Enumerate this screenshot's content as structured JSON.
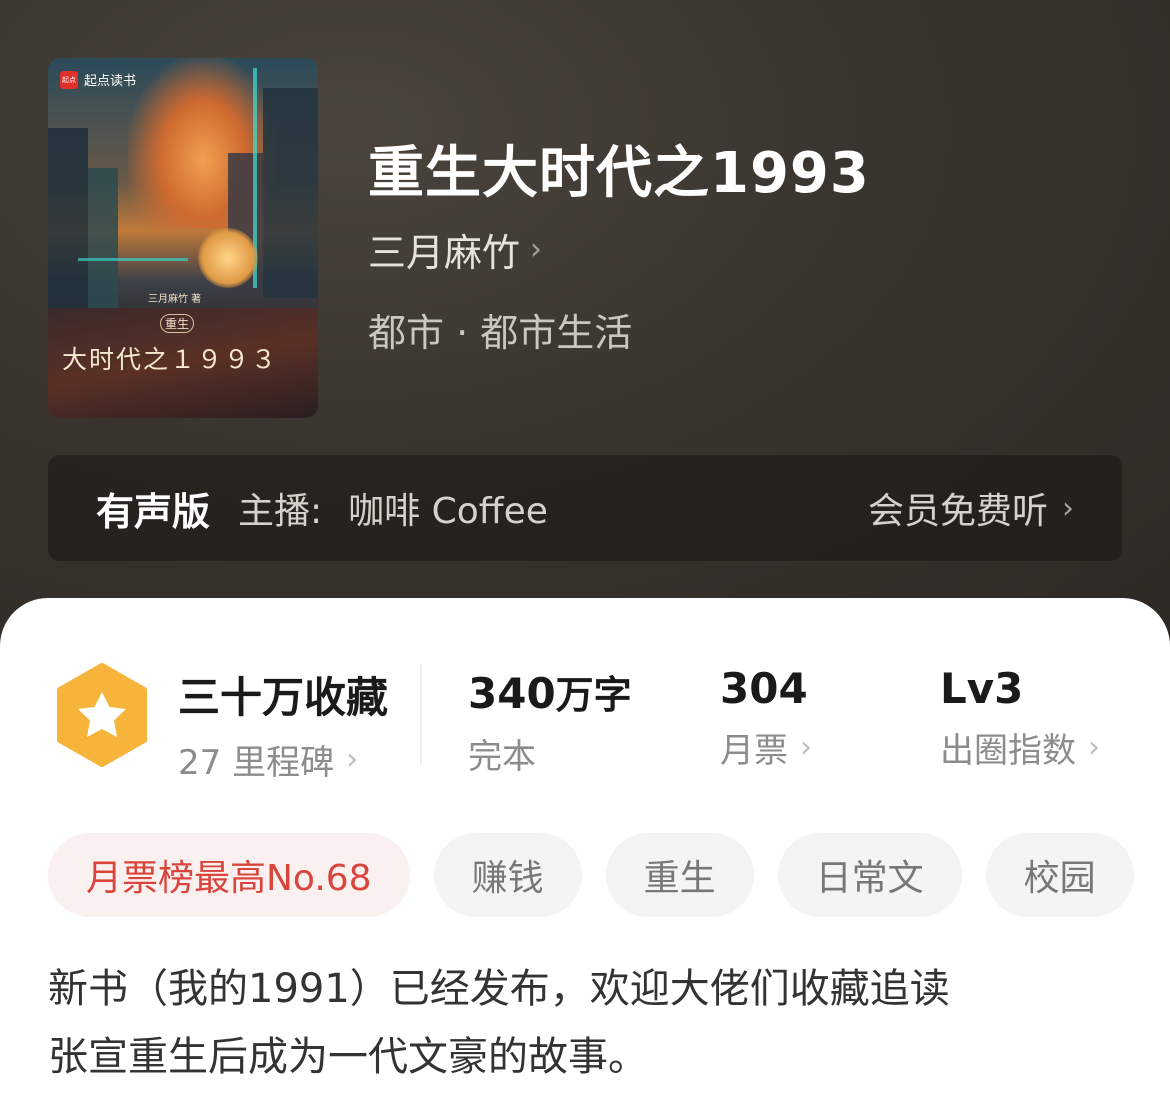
{
  "book": {
    "title": "重生大时代之1993",
    "author": "三月麻竹",
    "genre": "都市 · 都市生活",
    "cover": {
      "brand": "起点读书",
      "brand_logo": "起点",
      "author_line": "三月麻竹 著",
      "subtitle": "重生",
      "title_line": "大时代之１９９３"
    }
  },
  "audio": {
    "label": "有声版",
    "host_prefix": "主播:",
    "host_name": "咖啡 Coffee",
    "cta": "会员免费听"
  },
  "stats": {
    "collection": {
      "value": "三十万收藏",
      "sub": "27 里程碑"
    },
    "words": {
      "value": "340",
      "unit": "万字",
      "sub": "完本"
    },
    "votes": {
      "value": "304",
      "sub": "月票"
    },
    "level": {
      "value": "Lv3",
      "sub": "出圈指数"
    }
  },
  "tags": [
    "月票榜最高No.68",
    "赚钱",
    "重生",
    "日常文",
    "校园"
  ],
  "description": [
    "新书（我的1991）已经发布，欢迎大佬们收藏追读",
    "张宣重生后成为一代文豪的故事。"
  ],
  "colors": {
    "header_bg": "#3a342e",
    "badge_orange": "#f6b43a",
    "rank_tag_red": "#d9453d"
  }
}
